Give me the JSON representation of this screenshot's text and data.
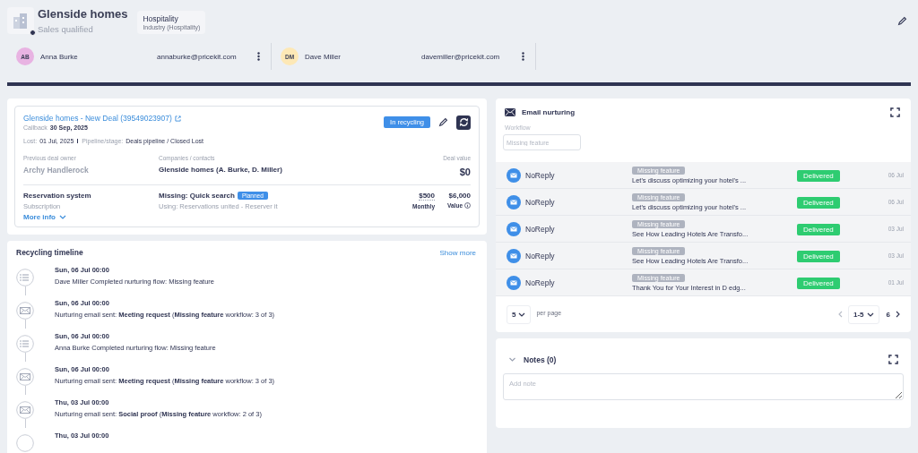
{
  "header": {
    "company": "Glenside homes",
    "stage": "Sales qualified",
    "industry": {
      "title": "Hospitality",
      "subtitle": "Industry (Hospitality)"
    }
  },
  "contacts": [
    {
      "initials": "AB",
      "name": "Anna Burke",
      "email": "annaburke@pricekit.com",
      "color": "#e8b3e2"
    },
    {
      "initials": "DM",
      "name": "Dave Miller",
      "email": "davemiller@pricekit.com",
      "color": "#fde8b6"
    }
  ],
  "deal": {
    "title": "Glenside homes - New Deal (39549023907)",
    "status_badge": "In recycling",
    "callback_label": "Callback",
    "callback_date": "30 Sep, 2025",
    "lost_label": "Lost:",
    "lost_date": "01 Jul, 2025",
    "pipeline_label": "Pipeline/stage:",
    "pipeline_value": "Deals pipeline / Closed Lost",
    "previous_owner_label": "Previous deal owner",
    "previous_owner": "Archy Handlerock",
    "companies_label": "Companies / contacts",
    "companies": "Glenside homes (A. Burke, D. Miller)",
    "deal_value_label": "Deal value",
    "deal_value": "$0",
    "product": {
      "name": "Reservation system",
      "type": "Subscription",
      "missing": "Missing: Quick search",
      "planned_badge": "Planned",
      "using": "Using: Reservations united - Reserver it",
      "monthly": "$500",
      "monthly_label": "Monthly",
      "value": "$6,000",
      "value_label": "Value"
    },
    "more_info": "More info"
  },
  "timeline": {
    "title": "Recycling timeline",
    "show_more": "Show more",
    "items": [
      {
        "kind": "flow",
        "date": "Sun, 06 Jul 00:00",
        "text": "Dave Miller Completed nurturing flow: Missing feature"
      },
      {
        "kind": "email",
        "date": "Sun, 06 Jul 00:00",
        "text": "Nurturing email sent: **Meeting request** (**Missing feature** workflow: 3 of 3)"
      },
      {
        "kind": "flow",
        "date": "Sun, 06 Jul 00:00",
        "text": "Anna Burke Completed nurturing flow: Missing feature"
      },
      {
        "kind": "email",
        "date": "Sun, 06 Jul 00:00",
        "text": "Nurturing email sent: **Meeting request** (**Missing feature** workflow: 3 of 3)"
      },
      {
        "kind": "email",
        "date": "Thu, 03 Jul 00:00",
        "text": "Nurturing email sent: **Social proof** (**Missing feature** workflow: 2 of 3)"
      },
      {
        "date": "Thu, 03 Jul 00:00"
      }
    ]
  },
  "email_nurturing": {
    "title": "Email nurturing",
    "workflow_label": "Workflow",
    "workflow_placeholder": "Missing feature",
    "rows": [
      {
        "sender": "NoReply",
        "tag": "Missing feature",
        "subject": "Let's discuss optimizing your hotel's ...",
        "status": "Delivered",
        "date": "06 Jul"
      },
      {
        "sender": "NoReply",
        "tag": "Missing feature",
        "subject": "Let's discuss optimizing your hotel's ...",
        "status": "Delivered",
        "date": "06 Jul"
      },
      {
        "sender": "NoReply",
        "tag": "Missing feature",
        "subject": "See How Leading Hotels Are Transfo...",
        "status": "Delivered",
        "date": "03 Jul"
      },
      {
        "sender": "NoReply",
        "tag": "Missing feature",
        "subject": "See How Leading Hotels Are Transfo...",
        "status": "Delivered",
        "date": "03 Jul"
      },
      {
        "sender": "NoReply",
        "tag": "Missing feature",
        "subject": "Thank You for Your Interest in D edg...",
        "status": "Delivered",
        "date": "01 Jul"
      }
    ],
    "per_page": "5",
    "per_page_label": "per page",
    "range": "1-5",
    "total": "6"
  },
  "notes": {
    "title": "Notes (0)",
    "placeholder": "Add note"
  }
}
